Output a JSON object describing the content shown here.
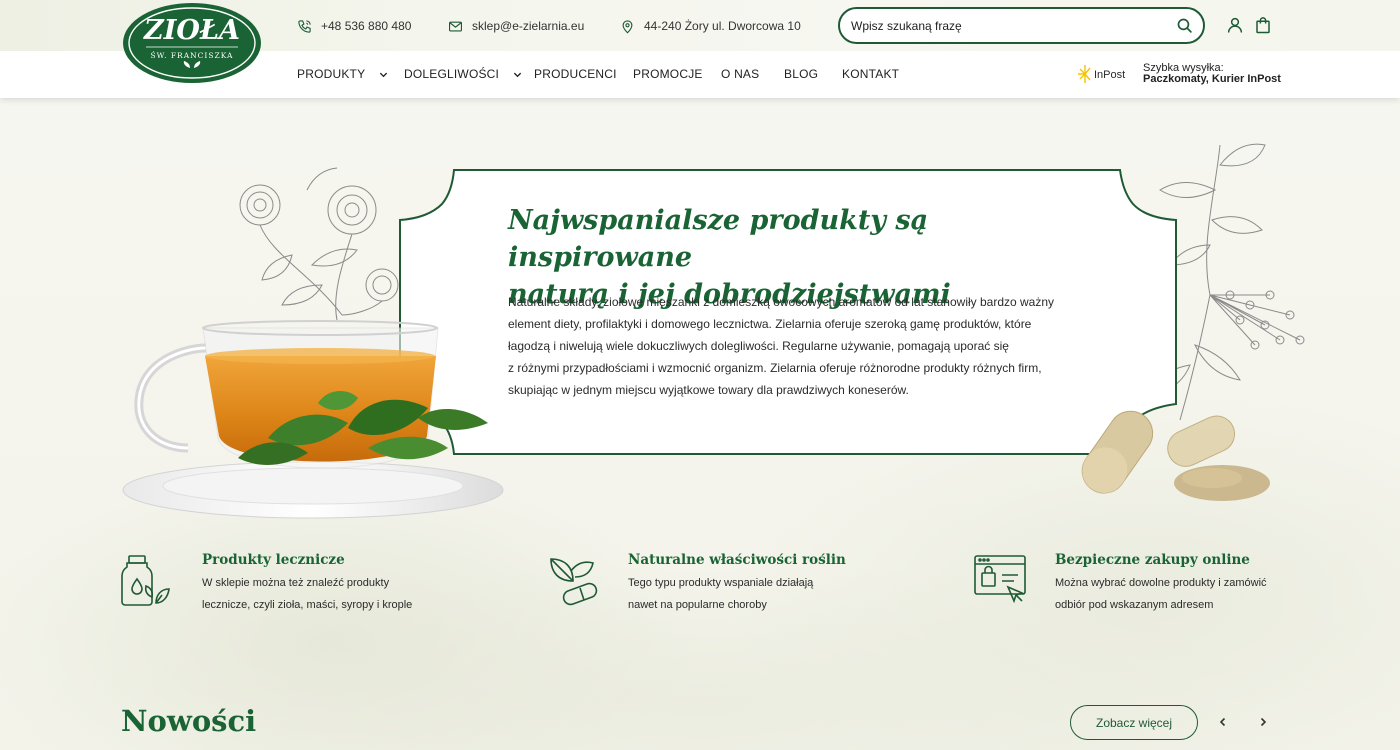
{
  "brand": {
    "logo_main": "ZIOŁA",
    "logo_sub": "ŚW. FRANCISZKA",
    "green": "#1a6334",
    "dark_green": "#1f5a35"
  },
  "contact": {
    "phone": "+48 536 880 480",
    "email": "sklep@e-zielarnia.eu",
    "address": "44-240 Żory ul. Dworcowa 10"
  },
  "search": {
    "placeholder": "Wpisz szukaną frazę"
  },
  "nav": {
    "items": [
      {
        "label": "PRODUKTY",
        "has_dropdown": true
      },
      {
        "label": "DOLEGLIWOŚCI",
        "has_dropdown": true
      },
      {
        "label": "PRODUCENCI",
        "has_dropdown": false
      },
      {
        "label": "PROMOCJE",
        "has_dropdown": false
      },
      {
        "label": "O NAS",
        "has_dropdown": false
      },
      {
        "label": "BLOG",
        "has_dropdown": false
      },
      {
        "label": "KONTAKT",
        "has_dropdown": false
      }
    ]
  },
  "shipping": {
    "logo_text": "InPost",
    "line1": "Szybka wysyłka:",
    "line2": "Paczkomaty, Kurier InPost"
  },
  "hero": {
    "title_line1": "Najwspanialsze produkty są inspirowane",
    "title_line2": "naturą i jej dobrodziejstwami",
    "text_lines": [
      "Naturalne składy, ziołowe mieszanki z domieszką owocowych aromatów od lat stanowiły bardzo ważny",
      "element diety, profilaktyki i domowego lecznictwa. Zielarnia oferuje szeroką gamę produktów, które",
      "łagodzą i niwelują wiele dokuczliwych dolegliwości. Regularne używanie, pomagają uporać się",
      "z różnymi przypadłościami i wzmocnić organizm. Zielarnia oferuje różnorodne produkty różnych firm,",
      "skupiając w jednym miejscu wyjątkowe towary dla prawdziwych koneserów."
    ]
  },
  "features": [
    {
      "icon": "medicine-bottle-icon",
      "title": "Produkty lecznicze",
      "line1": "W sklepie można też znaleźć produkty",
      "line2": "lecznicze, czyli zioła, maści, syropy i krople"
    },
    {
      "icon": "leaf-capsule-icon",
      "title": "Naturalne właściwości roślin",
      "line1": "Tego typu produkty wspaniale działają",
      "line2": "nawet na popularne choroby"
    },
    {
      "icon": "online-shop-icon",
      "title": "Bezpieczne zakupy online",
      "line1": "Można wybrać dowolne produkty i zamówić",
      "line2": "odbiór pod wskazanym adresem"
    }
  ],
  "news": {
    "title": "Nowości",
    "see_more": "Zobacz więcej",
    "prev": "‹",
    "next": "›"
  }
}
